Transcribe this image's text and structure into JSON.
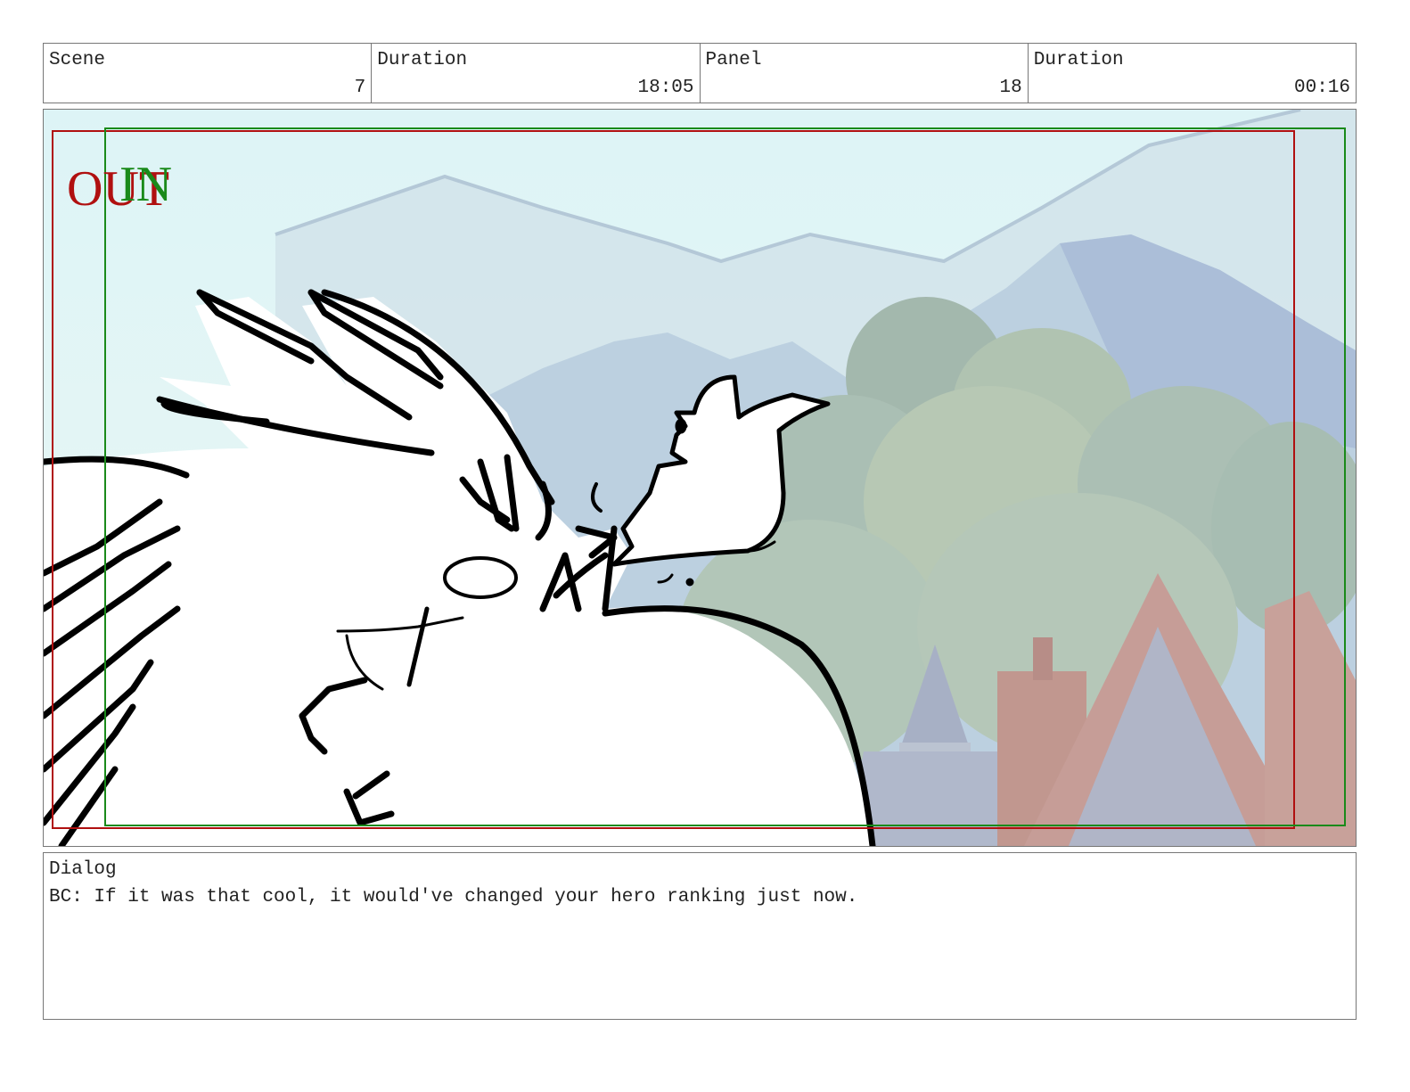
{
  "header": {
    "scene_label": "Scene",
    "scene_value": "7",
    "scene_duration_label": "Duration",
    "scene_duration_value": "18:05",
    "panel_label": "Panel",
    "panel_value": "18",
    "panel_duration_label": "Duration",
    "panel_duration_value": "00:16"
  },
  "panel": {
    "out_label": "OUT",
    "in_label": "IN",
    "colors": {
      "out_frame": "#b01010",
      "in_frame": "#1a8a1a",
      "sky": "#d8f2f4",
      "mountain": "#aac3d6",
      "trees": "#9fb7a6",
      "roof": "#b07a70",
      "glow": "#ffff30"
    }
  },
  "dialog": {
    "label": "Dialog",
    "text": "BC: If it was that cool, it would've changed your hero ranking just now."
  }
}
